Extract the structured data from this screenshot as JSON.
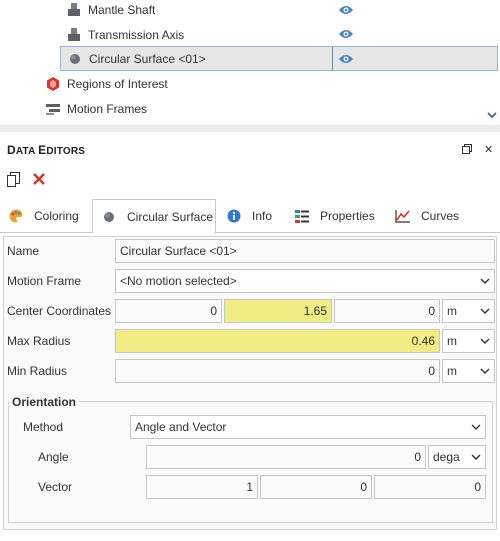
{
  "tree": {
    "items": [
      {
        "label": "Mantle Shaft",
        "icon": "mantle-shaft-icon",
        "visible": true
      },
      {
        "label": "Transmission Axis",
        "icon": "transmission-axis-icon",
        "visible": true
      },
      {
        "label": "Circular Surface <01>",
        "icon": "circular-surface-icon",
        "visible": true,
        "selected": true
      },
      {
        "label": "Regions of Interest",
        "icon": "regions-of-interest-icon"
      },
      {
        "label": "Motion Frames",
        "icon": "motion-frames-icon"
      }
    ]
  },
  "panel": {
    "title_first_D": "D",
    "title_ata": "ATA ",
    "title_first_E": "E",
    "title_ditors": "DITORS",
    "close_glyph": "✕"
  },
  "tabs": [
    {
      "label": "Coloring",
      "icon": "palette-icon"
    },
    {
      "label": "Circular Surface",
      "icon": "circular-surface-icon",
      "active": true
    },
    {
      "label": "Info",
      "icon": "info-icon"
    },
    {
      "label": "Properties",
      "icon": "properties-icon"
    },
    {
      "label": "Curves",
      "icon": "curves-icon"
    }
  ],
  "form": {
    "name": {
      "label": "Name",
      "value": "Circular Surface <01>"
    },
    "motion_frame": {
      "label": "Motion Frame",
      "value": "<No motion selected>"
    },
    "center": {
      "label": "Center Coordinates",
      "x": "0",
      "y": "1.65",
      "z": "0",
      "unit": "m"
    },
    "max_radius": {
      "label": "Max Radius",
      "value": "0.46",
      "unit": "m"
    },
    "min_radius": {
      "label": "Min Radius",
      "value": "0",
      "unit": "m"
    },
    "orientation": {
      "title": "Orientation",
      "method_label": "Method",
      "method_value": "Angle and Vector",
      "angle_label": "Angle",
      "angle_value": "0",
      "angle_unit": "dega",
      "vector_label": "Vector",
      "vector": [
        "1",
        "0",
        "0"
      ]
    }
  },
  "colors": {
    "highlight": "#f2ec85",
    "accent": "#4a86c5",
    "delete": "#d9342b"
  }
}
